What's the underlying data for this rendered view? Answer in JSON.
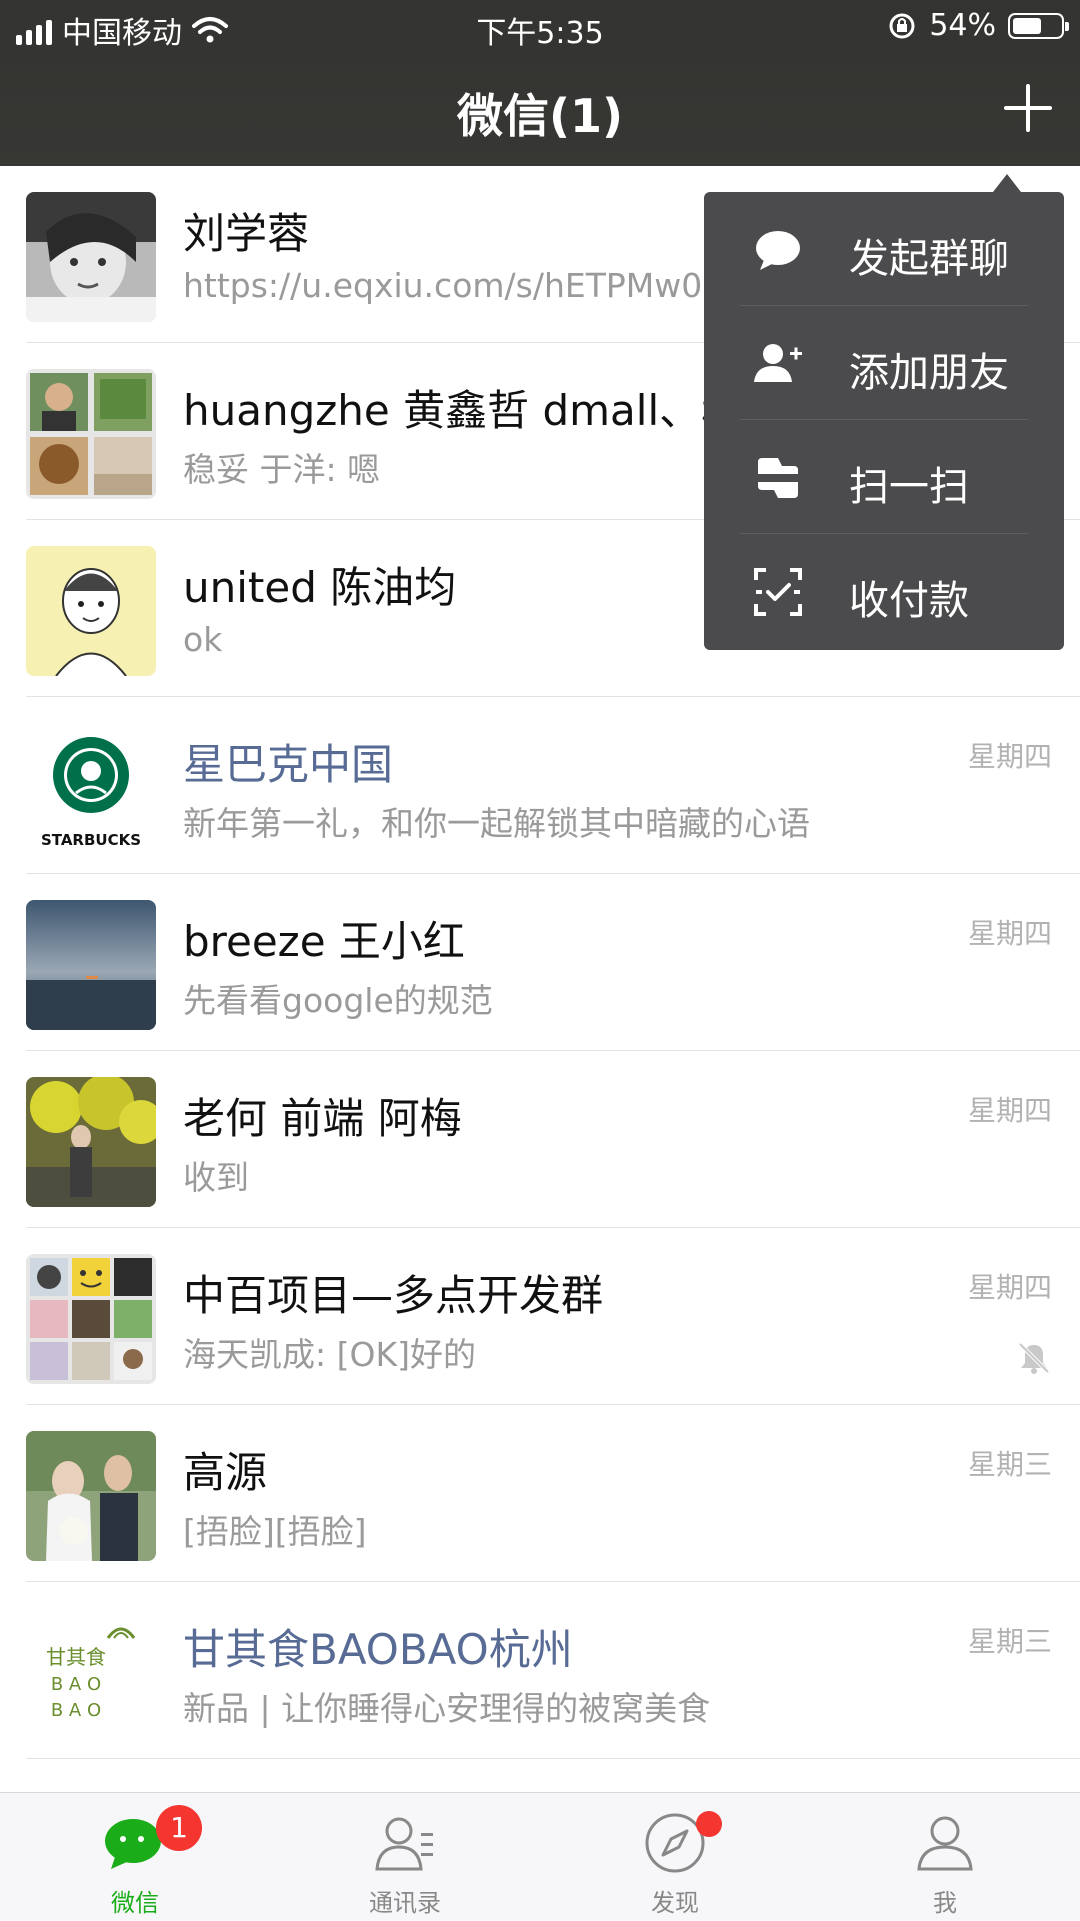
{
  "status_bar": {
    "carrier": "中国移动",
    "time": "下午5:35",
    "battery_percent": "54%"
  },
  "header": {
    "title": "微信(1)",
    "add_icon": "plus-icon"
  },
  "menu": {
    "items": [
      {
        "label": "发起群聊",
        "icon": "chat-bubble-icon"
      },
      {
        "label": "添加朋友",
        "icon": "add-friend-icon"
      },
      {
        "label": "扫一扫",
        "icon": "scan-icon"
      },
      {
        "label": "收付款",
        "icon": "payment-icon"
      }
    ]
  },
  "chats": [
    {
      "name": "刘学蓉",
      "preview": "https://u.eqxiu.com/s/hETPMw0",
      "time": ""
    },
    {
      "name": "huangzhe 黄鑫哲 dmall、稳",
      "preview": "稳妥 于洋: 嗯",
      "time": ""
    },
    {
      "name": "united 陈油均",
      "preview": "ok",
      "time": ""
    },
    {
      "name": "星巴克中国",
      "preview": "新年第一礼，和你一起解锁其中暗藏的心语",
      "time": "星期四",
      "avatar_text": "STARBUCKS"
    },
    {
      "name": "breeze 王小红",
      "preview": "先看看google的规范",
      "time": "星期四"
    },
    {
      "name": "老何 前端 阿梅",
      "preview": "收到",
      "time": "星期四"
    },
    {
      "name": "中百项目—多点开发群",
      "preview": "海天凯成: [OK]好的",
      "time": "星期四",
      "muted": true
    },
    {
      "name": "高源",
      "preview": "[捂脸][捂脸]",
      "time": "星期三"
    },
    {
      "name": "甘其食BAOBAO杭州",
      "preview": "新品 | 让你睡得心安理得的被窝美食",
      "time": "星期三",
      "avatar_text": [
        "甘其食",
        "B A O",
        "B A O"
      ]
    }
  ],
  "tabbar": {
    "tabs": [
      {
        "label": "微信",
        "badge": "1",
        "active": true
      },
      {
        "label": "通讯录"
      },
      {
        "label": "发现",
        "dot": true
      },
      {
        "label": "我"
      }
    ]
  },
  "colors": {
    "accent": "#1aad19",
    "official_name": "#576b95",
    "badge": "#f43530",
    "menu_bg": "#4b4b4d",
    "header_bg": "#353533"
  }
}
